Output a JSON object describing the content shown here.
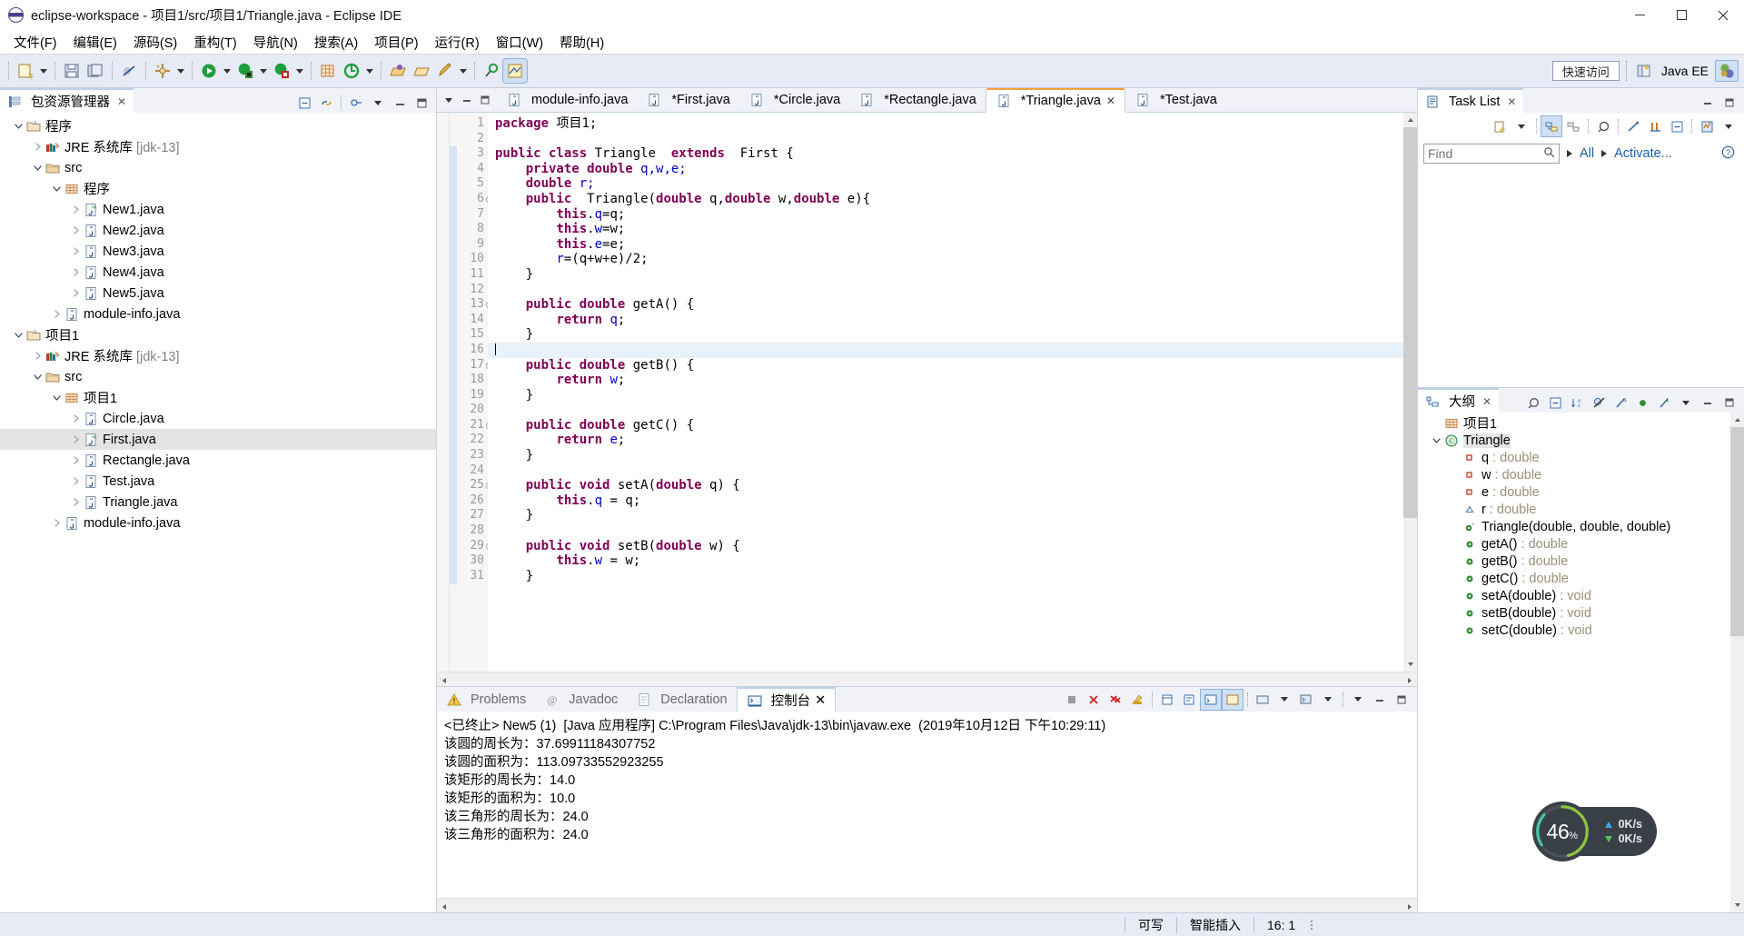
{
  "window": {
    "title": "eclipse-workspace - 项目1/src/项目1/Triangle.java - Eclipse IDE",
    "app_icon": "eclipse-icon",
    "minimize": "minimize-icon",
    "maximize": "maximize-icon",
    "close": "close-icon"
  },
  "menubar": {
    "items": [
      {
        "label": "文件(F)",
        "name": "menu-file"
      },
      {
        "label": "编辑(E)",
        "name": "menu-edit"
      },
      {
        "label": "源码(S)",
        "name": "menu-source"
      },
      {
        "label": "重构(T)",
        "name": "menu-refactor"
      },
      {
        "label": "导航(N)",
        "name": "menu-navigate"
      },
      {
        "label": "搜索(A)",
        "name": "menu-search"
      },
      {
        "label": "项目(P)",
        "name": "menu-project"
      },
      {
        "label": "运行(R)",
        "name": "menu-run"
      },
      {
        "label": "窗口(W)",
        "name": "menu-window"
      },
      {
        "label": "帮助(H)",
        "name": "menu-help"
      }
    ]
  },
  "toolbar": {
    "quick_access": "快速访问",
    "perspective_label": "Java EE",
    "icons": [
      "new-wizard-icon",
      "save-icon",
      "save-all-icon",
      "toggle-breakpoint-icon",
      "build-icon",
      "run-icon",
      "debug-icon",
      "coverage-icon",
      "new-java-project-icon",
      "external-tools-icon",
      "open-type-icon",
      "open-task-icon",
      "search-icon",
      "new-perspective-icon"
    ]
  },
  "sidebar": {
    "tab_title": "包资源管理器",
    "tab_close": "close-icon",
    "tools": [
      "collapse-all-icon",
      "link-with-editor-icon",
      "view-menu-icon",
      "minimize-icon",
      "maximize-icon"
    ],
    "tree": [
      {
        "indent": 0,
        "twisty": "down",
        "icon": "java-project-icon",
        "label": "程序",
        "dim": ""
      },
      {
        "indent": 1,
        "twisty": "right",
        "icon": "jre-library-icon",
        "label": "JRE 系统库",
        "dim": "[jdk-13]"
      },
      {
        "indent": 1,
        "twisty": "down",
        "icon": "source-folder-icon",
        "label": "src",
        "dim": ""
      },
      {
        "indent": 2,
        "twisty": "down",
        "icon": "package-icon",
        "label": "程序",
        "dim": ""
      },
      {
        "indent": 3,
        "twisty": "right",
        "icon": "java-main-icon",
        "label": "New1.java",
        "dim": ""
      },
      {
        "indent": 3,
        "twisty": "right",
        "icon": "java-file-icon",
        "label": "New2.java",
        "dim": ""
      },
      {
        "indent": 3,
        "twisty": "right",
        "icon": "java-file-icon",
        "label": "New3.java",
        "dim": ""
      },
      {
        "indent": 3,
        "twisty": "right",
        "icon": "java-file-icon",
        "label": "New4.java",
        "dim": ""
      },
      {
        "indent": 3,
        "twisty": "right",
        "icon": "java-file-icon",
        "label": "New5.java",
        "dim": ""
      },
      {
        "indent": 2,
        "twisty": "right",
        "icon": "java-file-icon",
        "label": "module-info.java",
        "dim": ""
      },
      {
        "indent": 0,
        "twisty": "down",
        "icon": "java-project-icon",
        "label": "项目1",
        "dim": ""
      },
      {
        "indent": 1,
        "twisty": "right",
        "icon": "jre-library-icon",
        "label": "JRE 系统库",
        "dim": "[jdk-13]"
      },
      {
        "indent": 1,
        "twisty": "down",
        "icon": "source-folder-icon",
        "label": "src",
        "dim": ""
      },
      {
        "indent": 2,
        "twisty": "down",
        "icon": "package-icon",
        "label": "项目1",
        "dim": ""
      },
      {
        "indent": 3,
        "twisty": "right",
        "icon": "java-file-icon",
        "label": "Circle.java",
        "dim": ""
      },
      {
        "indent": 3,
        "twisty": "right",
        "icon": "java-main-icon",
        "label": "First.java",
        "dim": "",
        "selected": true
      },
      {
        "indent": 3,
        "twisty": "right",
        "icon": "java-file-icon",
        "label": "Rectangle.java",
        "dim": ""
      },
      {
        "indent": 3,
        "twisty": "right",
        "icon": "java-file-icon",
        "label": "Test.java",
        "dim": ""
      },
      {
        "indent": 3,
        "twisty": "right",
        "icon": "java-file-icon",
        "label": "Triangle.java",
        "dim": ""
      },
      {
        "indent": 2,
        "twisty": "right",
        "icon": "java-file-icon",
        "label": "module-info.java",
        "dim": ""
      }
    ]
  },
  "editor": {
    "tabs": [
      {
        "label": "module-info.java",
        "active": false,
        "dirty": false
      },
      {
        "label": "*First.java",
        "active": false,
        "dirty": true
      },
      {
        "label": "*Circle.java",
        "active": false,
        "dirty": true
      },
      {
        "label": "*Rectangle.java",
        "active": false,
        "dirty": true
      },
      {
        "label": "*Triangle.java",
        "active": true,
        "dirty": true
      },
      {
        "label": "*Test.java",
        "active": false,
        "dirty": true
      }
    ],
    "current_line": 16,
    "lines": [
      {
        "n": 1,
        "fold": false,
        "marker": false,
        "tokens": [
          [
            "kw",
            "package"
          ],
          [
            "pl",
            " 项目1;"
          ]
        ]
      },
      {
        "n": 2,
        "fold": false,
        "marker": false,
        "tokens": []
      },
      {
        "n": 3,
        "fold": false,
        "marker": true,
        "tokens": [
          [
            "kw",
            "public class"
          ],
          [
            "pl",
            " Triangle  "
          ],
          [
            "kw",
            "extends"
          ],
          [
            "pl",
            "  First {"
          ]
        ]
      },
      {
        "n": 4,
        "fold": false,
        "marker": true,
        "tokens": [
          [
            "pl",
            "    "
          ],
          [
            "kw",
            "private double"
          ],
          [
            "fld",
            " q,w,e;"
          ]
        ]
      },
      {
        "n": 5,
        "fold": false,
        "marker": true,
        "tokens": [
          [
            "pl",
            "    "
          ],
          [
            "kw",
            "double"
          ],
          [
            "fld",
            " r;"
          ]
        ]
      },
      {
        "n": 6,
        "fold": true,
        "marker": true,
        "tokens": [
          [
            "pl",
            "    "
          ],
          [
            "kw",
            "public"
          ],
          [
            "pl",
            "  Triangle("
          ],
          [
            "kw",
            "double"
          ],
          [
            "pl",
            " q,"
          ],
          [
            "kw",
            "double"
          ],
          [
            "pl",
            " w,"
          ],
          [
            "kw",
            "double"
          ],
          [
            "pl",
            " e){"
          ]
        ]
      },
      {
        "n": 7,
        "fold": false,
        "marker": true,
        "tokens": [
          [
            "pl",
            "        "
          ],
          [
            "kw",
            "this"
          ],
          [
            "pl",
            "."
          ],
          [
            "fld",
            "q"
          ],
          [
            "pl",
            "=q;"
          ]
        ]
      },
      {
        "n": 8,
        "fold": false,
        "marker": true,
        "tokens": [
          [
            "pl",
            "        "
          ],
          [
            "kw",
            "this"
          ],
          [
            "pl",
            "."
          ],
          [
            "fld",
            "w"
          ],
          [
            "pl",
            "=w;"
          ]
        ]
      },
      {
        "n": 9,
        "fold": false,
        "marker": true,
        "tokens": [
          [
            "pl",
            "        "
          ],
          [
            "kw",
            "this"
          ],
          [
            "pl",
            "."
          ],
          [
            "fld",
            "e"
          ],
          [
            "pl",
            "=e;"
          ]
        ]
      },
      {
        "n": 10,
        "fold": false,
        "marker": true,
        "tokens": [
          [
            "pl",
            "        "
          ],
          [
            "fld",
            "r"
          ],
          [
            "pl",
            "=(q+w+e)/2;"
          ]
        ]
      },
      {
        "n": 11,
        "fold": false,
        "marker": true,
        "tokens": [
          [
            "pl",
            "    }"
          ]
        ]
      },
      {
        "n": 12,
        "fold": false,
        "marker": true,
        "tokens": []
      },
      {
        "n": 13,
        "fold": true,
        "marker": true,
        "tokens": [
          [
            "pl",
            "    "
          ],
          [
            "kw",
            "public double"
          ],
          [
            "pl",
            " getA() {"
          ]
        ]
      },
      {
        "n": 14,
        "fold": false,
        "marker": true,
        "tokens": [
          [
            "pl",
            "        "
          ],
          [
            "kw",
            "return"
          ],
          [
            "fld",
            " q"
          ],
          [
            "pl",
            ";"
          ]
        ]
      },
      {
        "n": 15,
        "fold": false,
        "marker": true,
        "tokens": [
          [
            "pl",
            "    }"
          ]
        ]
      },
      {
        "n": 16,
        "fold": false,
        "marker": true,
        "tokens": [],
        "caret": true
      },
      {
        "n": 17,
        "fold": true,
        "marker": true,
        "tokens": [
          [
            "pl",
            "    "
          ],
          [
            "kw",
            "public double"
          ],
          [
            "pl",
            " getB() {"
          ]
        ]
      },
      {
        "n": 18,
        "fold": false,
        "marker": true,
        "tokens": [
          [
            "pl",
            "        "
          ],
          [
            "kw",
            "return"
          ],
          [
            "fld",
            " w"
          ],
          [
            "pl",
            ";"
          ]
        ]
      },
      {
        "n": 19,
        "fold": false,
        "marker": true,
        "tokens": [
          [
            "pl",
            "    }"
          ]
        ]
      },
      {
        "n": 20,
        "fold": false,
        "marker": true,
        "tokens": []
      },
      {
        "n": 21,
        "fold": true,
        "marker": true,
        "tokens": [
          [
            "pl",
            "    "
          ],
          [
            "kw",
            "public double"
          ],
          [
            "pl",
            " getC() {"
          ]
        ]
      },
      {
        "n": 22,
        "fold": false,
        "marker": true,
        "tokens": [
          [
            "pl",
            "        "
          ],
          [
            "kw",
            "return"
          ],
          [
            "fld",
            " e"
          ],
          [
            "pl",
            ";"
          ]
        ]
      },
      {
        "n": 23,
        "fold": false,
        "marker": true,
        "tokens": [
          [
            "pl",
            "    }"
          ]
        ]
      },
      {
        "n": 24,
        "fold": false,
        "marker": true,
        "tokens": []
      },
      {
        "n": 25,
        "fold": true,
        "marker": true,
        "tokens": [
          [
            "pl",
            "    "
          ],
          [
            "kw",
            "public void"
          ],
          [
            "pl",
            " setA("
          ],
          [
            "kw",
            "double"
          ],
          [
            "pl",
            " q) {"
          ]
        ]
      },
      {
        "n": 26,
        "fold": false,
        "marker": true,
        "tokens": [
          [
            "pl",
            "        "
          ],
          [
            "kw",
            "this"
          ],
          [
            "pl",
            "."
          ],
          [
            "fld",
            "q"
          ],
          [
            "pl",
            " = q;"
          ]
        ]
      },
      {
        "n": 27,
        "fold": false,
        "marker": true,
        "tokens": [
          [
            "pl",
            "    }"
          ]
        ]
      },
      {
        "n": 28,
        "fold": false,
        "marker": true,
        "tokens": []
      },
      {
        "n": 29,
        "fold": true,
        "marker": true,
        "tokens": [
          [
            "pl",
            "    "
          ],
          [
            "kw",
            "public void"
          ],
          [
            "pl",
            " setB("
          ],
          [
            "kw",
            "double"
          ],
          [
            "pl",
            " w) {"
          ]
        ]
      },
      {
        "n": 30,
        "fold": false,
        "marker": true,
        "tokens": [
          [
            "pl",
            "        "
          ],
          [
            "kw",
            "this"
          ],
          [
            "pl",
            "."
          ],
          [
            "fld",
            "w"
          ],
          [
            "pl",
            " = w;"
          ]
        ]
      },
      {
        "n": 31,
        "fold": false,
        "marker": true,
        "tokens": [
          [
            "pl",
            "    }"
          ]
        ]
      }
    ]
  },
  "console": {
    "tabs": [
      {
        "label": "Problems",
        "icon": "problems-icon",
        "active": false
      },
      {
        "label": "Javadoc",
        "icon": "javadoc-icon",
        "active": false
      },
      {
        "label": "Declaration",
        "icon": "declaration-icon",
        "active": false
      },
      {
        "label": "控制台",
        "icon": "console-icon",
        "active": true
      }
    ],
    "header": "<已终止> New5 (1)  [Java 应用程序] C:\\Program Files\\Java\\jdk-13\\bin\\javaw.exe  (2019年10月12日 下午10:29:11)",
    "output": [
      "该圆的周长为：37.69911184307752",
      "该圆的面积为：113.09733552923255",
      "该矩形的周长为：14.0",
      "该矩形的面积为：10.0",
      "该三角形的周长为：24.0",
      "该三角形的面积为：24.0"
    ],
    "tools": [
      "terminate-icon",
      "remove-launch-icon",
      "remove-all-icon",
      "clear-console-icon",
      "scroll-lock-icon",
      "word-wrap-icon",
      "show-console-icon",
      "pin-console-icon",
      "display-selected-console-icon",
      "open-console-icon",
      "view-menu-icon",
      "minimize-icon",
      "maximize-icon"
    ]
  },
  "tasklist": {
    "title": "Task List",
    "tab_close": "close-icon",
    "find_placeholder": "Find",
    "find_value": "",
    "filter_all": "All",
    "filter_activate": "Activate...",
    "help": "help-icon",
    "tools": [
      "new-task-icon",
      "categorized-icon",
      "scheduled-icon",
      "synchronize-icon",
      "collapse-all-icon",
      "focus-icon",
      "view-menu-icon",
      "minimize-icon",
      "maximize-icon"
    ]
  },
  "outline": {
    "title": "大纲",
    "tab_close": "close-icon",
    "tools": [
      "link-icon",
      "collapse-all-icon",
      "sort-icon",
      "hide-fields-icon",
      "hide-static-icon",
      "hide-nonpublic-icon",
      "hide-local-icon",
      "view-menu-icon",
      "minimize-icon",
      "maximize-icon"
    ],
    "items": [
      {
        "indent": 0,
        "twisty": "none",
        "icon": "package-icon",
        "label": "项目1",
        "type": ""
      },
      {
        "indent": 0,
        "twisty": "down",
        "icon": "class-icon",
        "label": "Triangle",
        "type": "",
        "selected": true
      },
      {
        "indent": 1,
        "twisty": "none",
        "icon": "field-private-icon",
        "label": "q",
        "type": " : double"
      },
      {
        "indent": 1,
        "twisty": "none",
        "icon": "field-private-icon",
        "label": "w",
        "type": " : double"
      },
      {
        "indent": 1,
        "twisty": "none",
        "icon": "field-private-icon",
        "label": "e",
        "type": " : double"
      },
      {
        "indent": 1,
        "twisty": "none",
        "icon": "field-default-icon",
        "label": "r",
        "type": " : double"
      },
      {
        "indent": 1,
        "twisty": "none",
        "icon": "constructor-icon",
        "label": "Triangle(double, double, double)",
        "type": ""
      },
      {
        "indent": 1,
        "twisty": "none",
        "icon": "method-public-icon",
        "label": "getA()",
        "type": " : double"
      },
      {
        "indent": 1,
        "twisty": "none",
        "icon": "method-public-icon",
        "label": "getB()",
        "type": " : double"
      },
      {
        "indent": 1,
        "twisty": "none",
        "icon": "method-public-icon",
        "label": "getC()",
        "type": " : double"
      },
      {
        "indent": 1,
        "twisty": "none",
        "icon": "method-public-icon",
        "label": "setA(double)",
        "type": " : void"
      },
      {
        "indent": 1,
        "twisty": "none",
        "icon": "method-public-icon",
        "label": "setB(double)",
        "type": " : void"
      },
      {
        "indent": 1,
        "twisty": "none",
        "icon": "method-public-icon",
        "label": "setC(double)",
        "type": " : void"
      }
    ]
  },
  "statusbar": {
    "writable": "可写",
    "insert_mode": "智能插入",
    "position": "16: 1"
  },
  "netmonitor": {
    "cpu_percent": "46",
    "percent_sign": "%",
    "upload": "0K/s",
    "download": "0K/s",
    "ring_color": "#8ec63f",
    "up_color": "#3fa5e6",
    "down_color": "#5bbd5b"
  }
}
